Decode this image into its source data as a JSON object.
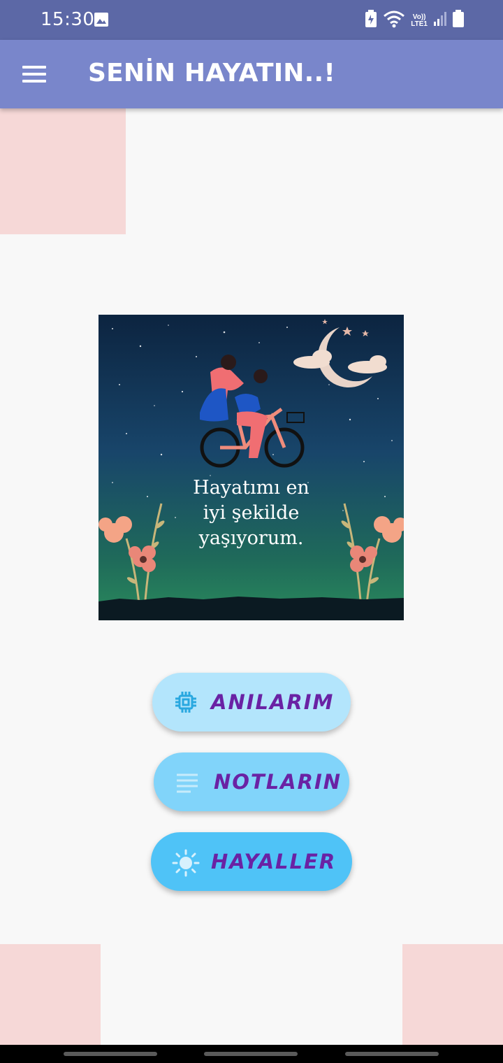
{
  "status_bar": {
    "time": "15:30",
    "lte_top": "Vo))",
    "lte_bottom": "LTE1",
    "icons": [
      "gallery-icon",
      "battery-saver-icon",
      "wifi-icon",
      "signal-icon",
      "battery-icon"
    ]
  },
  "app_bar": {
    "title": "SENİN HAYATIN..!",
    "menu_icon": "hamburger-menu-icon",
    "background": "#7986cb"
  },
  "poster": {
    "line1": "Hayatımı en",
    "line2": "iyi şekilde",
    "line3": "yaşıyorum."
  },
  "buttons": [
    {
      "label": "ANILARIM",
      "icon": "chip-icon",
      "background": "#b3e5fc"
    },
    {
      "label": "NOTLARIN",
      "icon": "notes-lines-icon",
      "background": "#81d4fa"
    },
    {
      "label": "HAYALLER",
      "icon": "sun-icon",
      "background": "#4fc3f7"
    }
  ],
  "colors": {
    "status_bar": "#5c68a6",
    "deco_pink": "#f6d8d7",
    "button_text": "#6a22a4",
    "page_background": "#f8f8f8"
  }
}
